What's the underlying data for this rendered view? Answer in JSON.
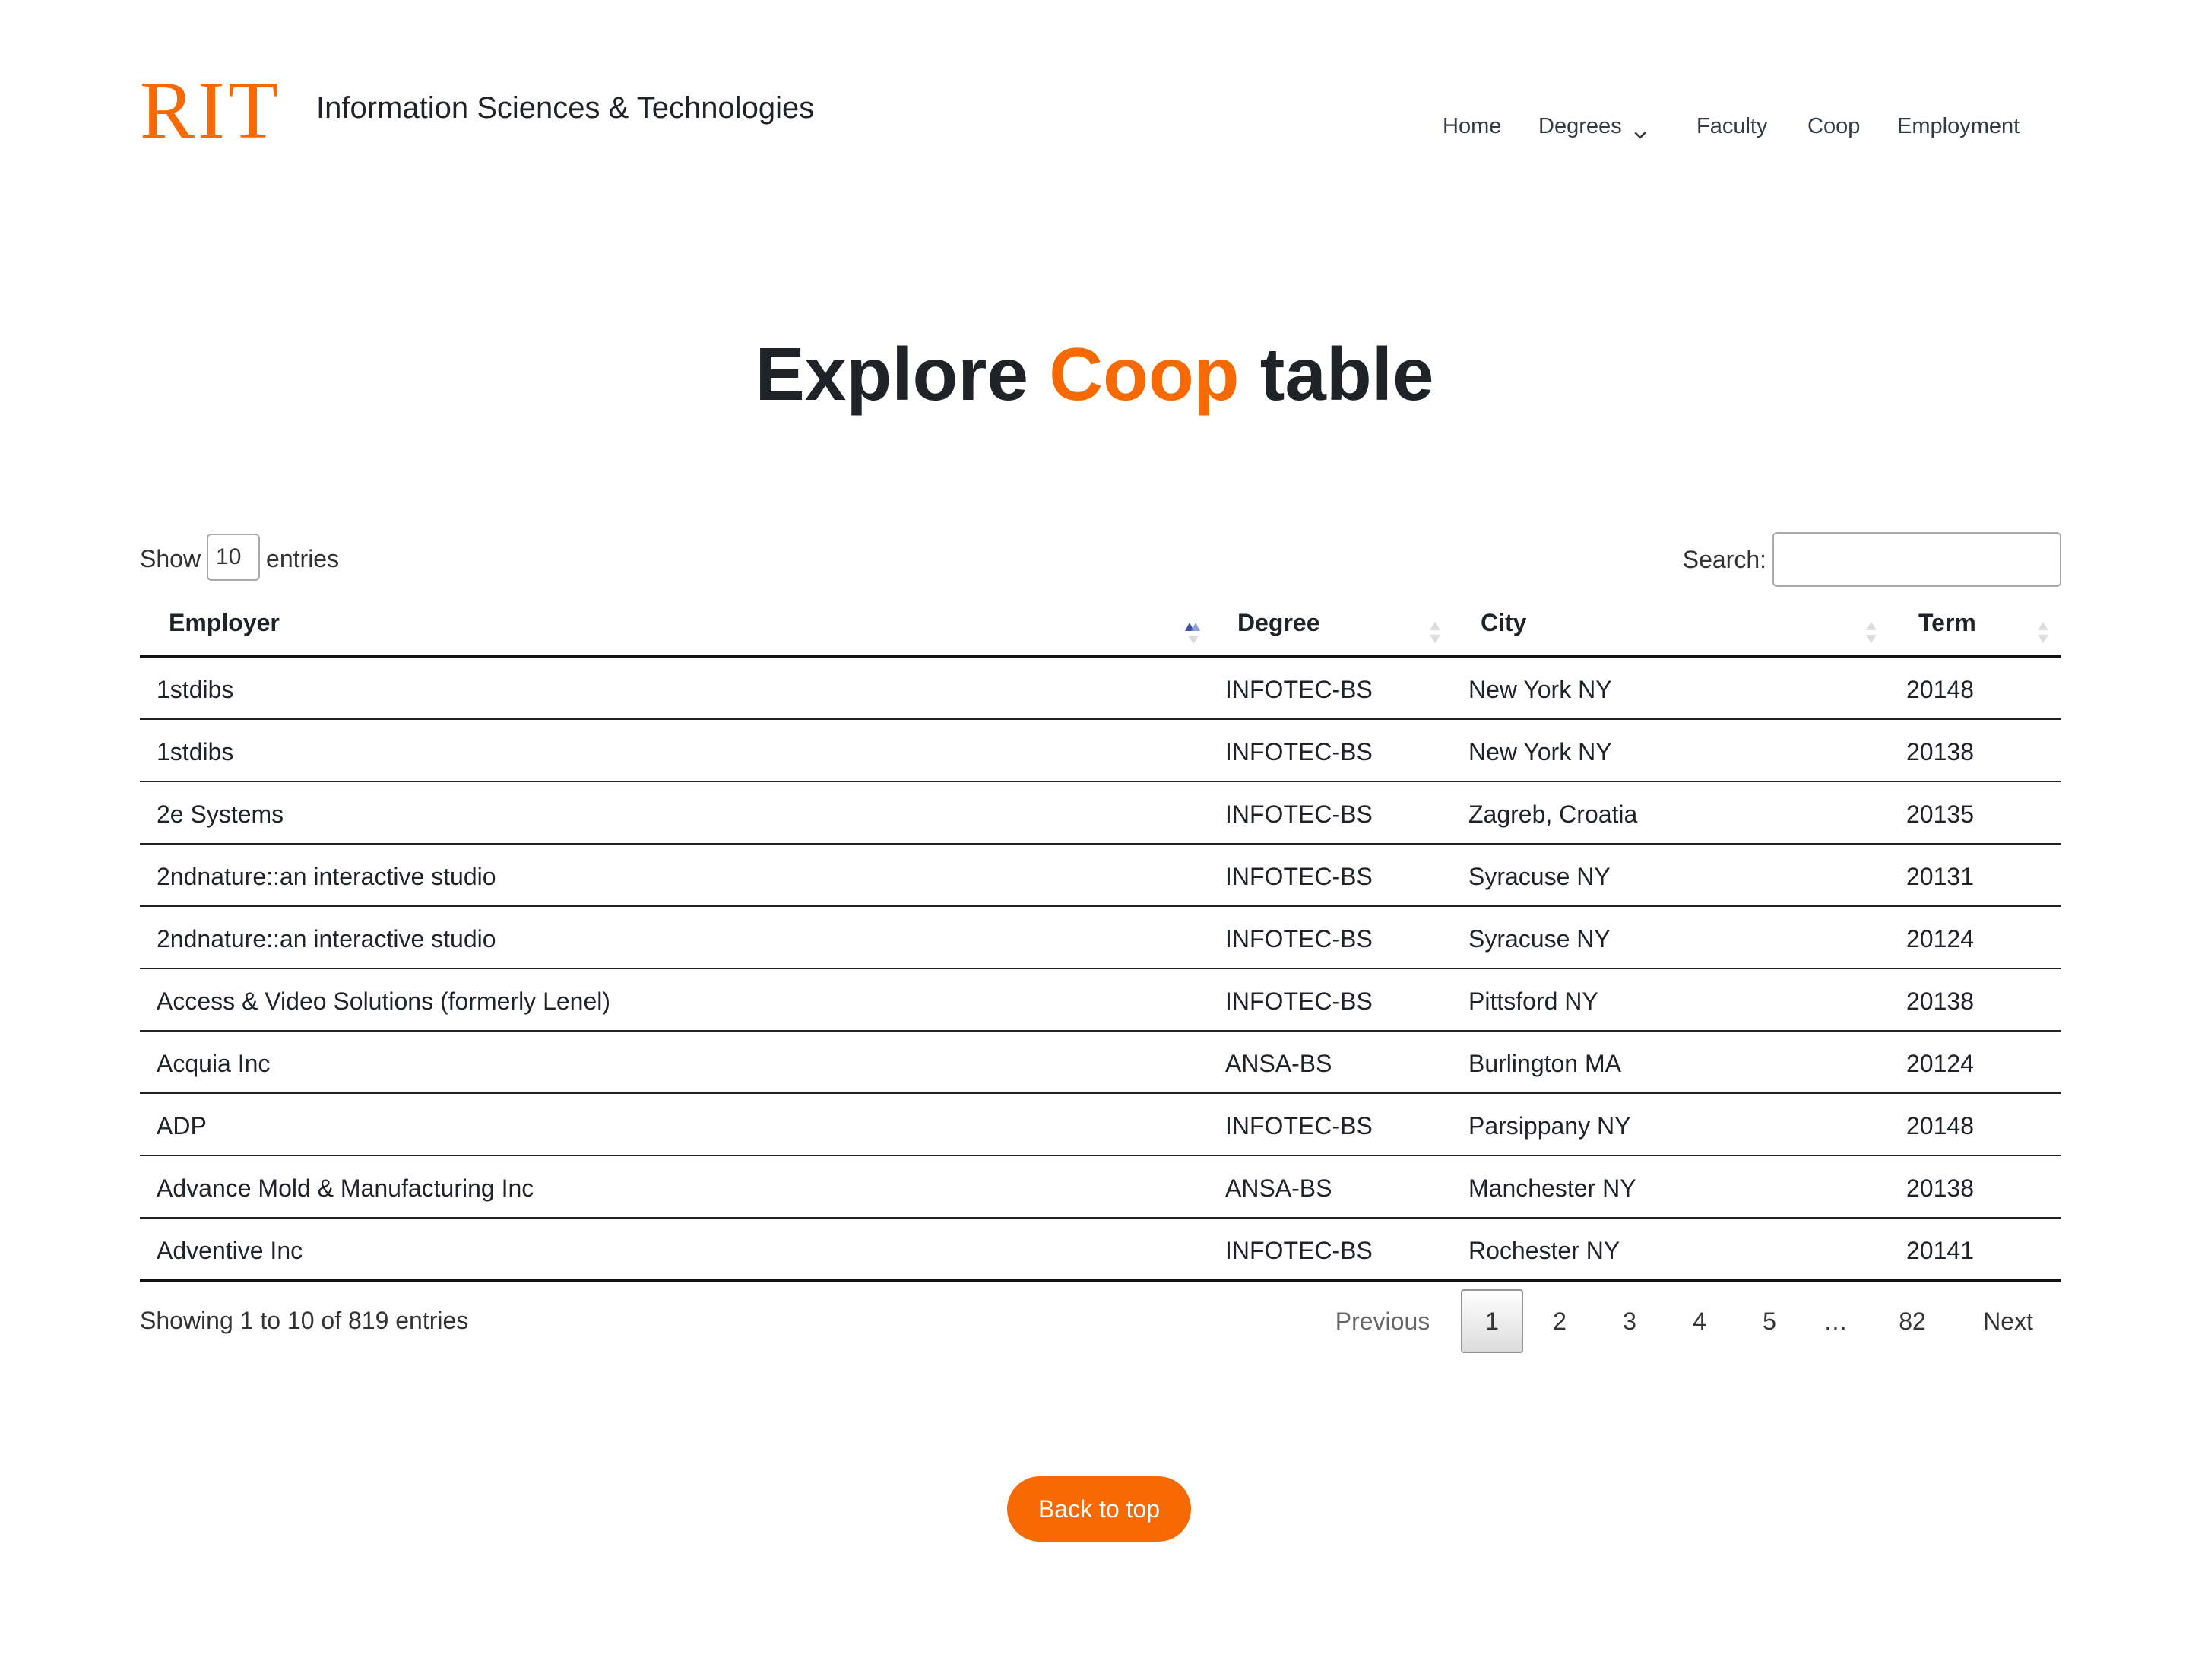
{
  "header": {
    "logo_text": "RIT",
    "site_name": "Information Sciences & Technologies",
    "nav": [
      {
        "label": "Home"
      },
      {
        "label": "Degrees"
      },
      {
        "label": "Faculty"
      },
      {
        "label": "Coop"
      },
      {
        "label": "Employment"
      }
    ]
  },
  "title": {
    "prefix": "Explore",
    "accent": "Coop",
    "suffix": "table"
  },
  "controls": {
    "show_label": "Show",
    "entries_value": "10",
    "entries_label": "entries",
    "search_label": "Search:",
    "search_value": "",
    "search_placeholder": ""
  },
  "table": {
    "columns": [
      "Employer",
      "Degree",
      "City",
      "Term"
    ],
    "sorted_column": "Employer",
    "sort_direction": "ascending",
    "rows": [
      [
        "1stdibs",
        "INFOTEC-BS",
        "New York NY",
        "20148"
      ],
      [
        "1stdibs",
        "INFOTEC-BS",
        "New York NY",
        "20138"
      ],
      [
        "2e Systems",
        "INFOTEC-BS",
        "Zagreb, Croatia",
        "20135"
      ],
      [
        "2ndnature::an interactive studio",
        "INFOTEC-BS",
        "Syracuse NY",
        "20131"
      ],
      [
        "2ndnature::an interactive studio",
        "INFOTEC-BS",
        "Syracuse NY",
        "20124"
      ],
      [
        "Access & Video Solutions (formerly Lenel)",
        "INFOTEC-BS",
        "Pittsford NY",
        "20138"
      ],
      [
        "Acquia Inc",
        "ANSA-BS",
        "Burlington MA",
        "20124"
      ],
      [
        "ADP",
        "INFOTEC-BS",
        "Parsippany NY",
        "20148"
      ],
      [
        "Advance Mold & Manufacturing Inc",
        "ANSA-BS",
        "Manchester NY",
        "20138"
      ],
      [
        "Adventive Inc",
        "INFOTEC-BS",
        "Rochester NY",
        "20141"
      ]
    ]
  },
  "footer_table": {
    "info": "Showing 1 to 10 of 819 entries",
    "pagination": {
      "previous": "Previous",
      "pages": [
        "1",
        "2",
        "3",
        "4",
        "5",
        "…",
        "82"
      ],
      "current_page": "1",
      "next": "Next"
    }
  },
  "back_to_top": "Back to top",
  "colors": {
    "brand": "#f76902",
    "text": "#1f2328"
  }
}
